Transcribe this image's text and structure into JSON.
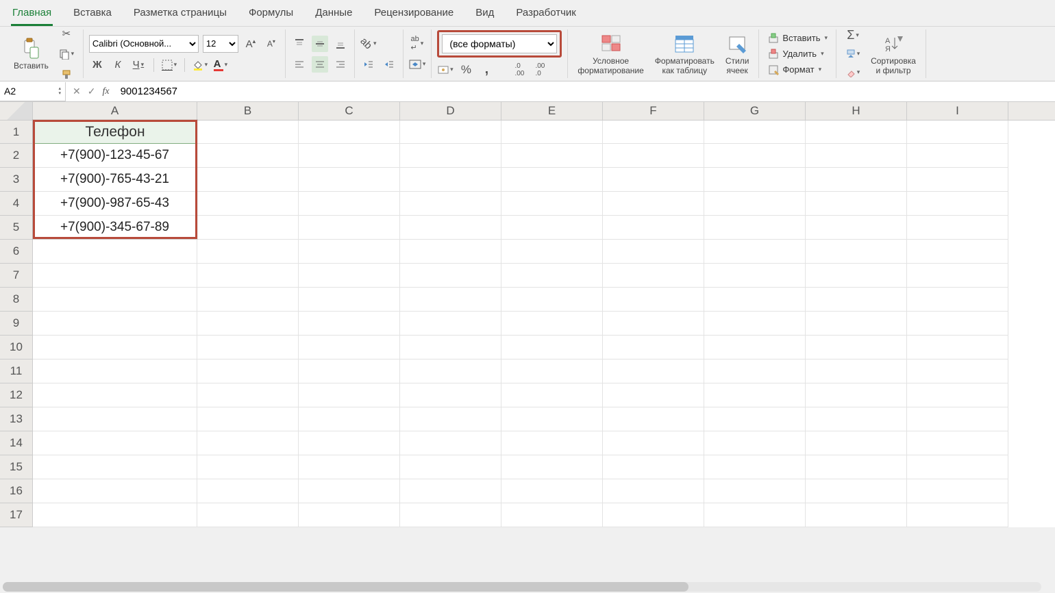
{
  "tabs": {
    "main": "Главная",
    "insert": "Вставка",
    "layout": "Разметка страницы",
    "formulas": "Формулы",
    "data": "Данные",
    "review": "Рецензирование",
    "view": "Вид",
    "developer": "Разработчик"
  },
  "clipboard": {
    "paste": "Вставить"
  },
  "font": {
    "name": "Calibri (Основной...",
    "size": "12"
  },
  "number": {
    "format": "(все форматы)"
  },
  "styles": {
    "cond": "Условное\nформатирование",
    "table": "Форматировать\nкак таблицу",
    "cell": "Стили\nячеек"
  },
  "cells": {
    "insert": "Вставить",
    "delete": "Удалить",
    "format": "Формат"
  },
  "editing": {
    "sort": "Сортировка\nи фильтр"
  },
  "namebox": "A2",
  "formula": "9001234567",
  "columns": [
    "A",
    "B",
    "C",
    "D",
    "E",
    "F",
    "G",
    "H",
    "I"
  ],
  "rows": [
    "1",
    "2",
    "3",
    "4",
    "5",
    "6",
    "7",
    "8",
    "9",
    "10",
    "11",
    "12",
    "13",
    "14",
    "15",
    "16",
    "17"
  ],
  "sheet": {
    "header": "Телефон",
    "values": [
      "+7(900)-123-45-67",
      "+7(900)-765-43-21",
      "+7(900)-987-65-43",
      "+7(900)-345-67-89"
    ]
  }
}
